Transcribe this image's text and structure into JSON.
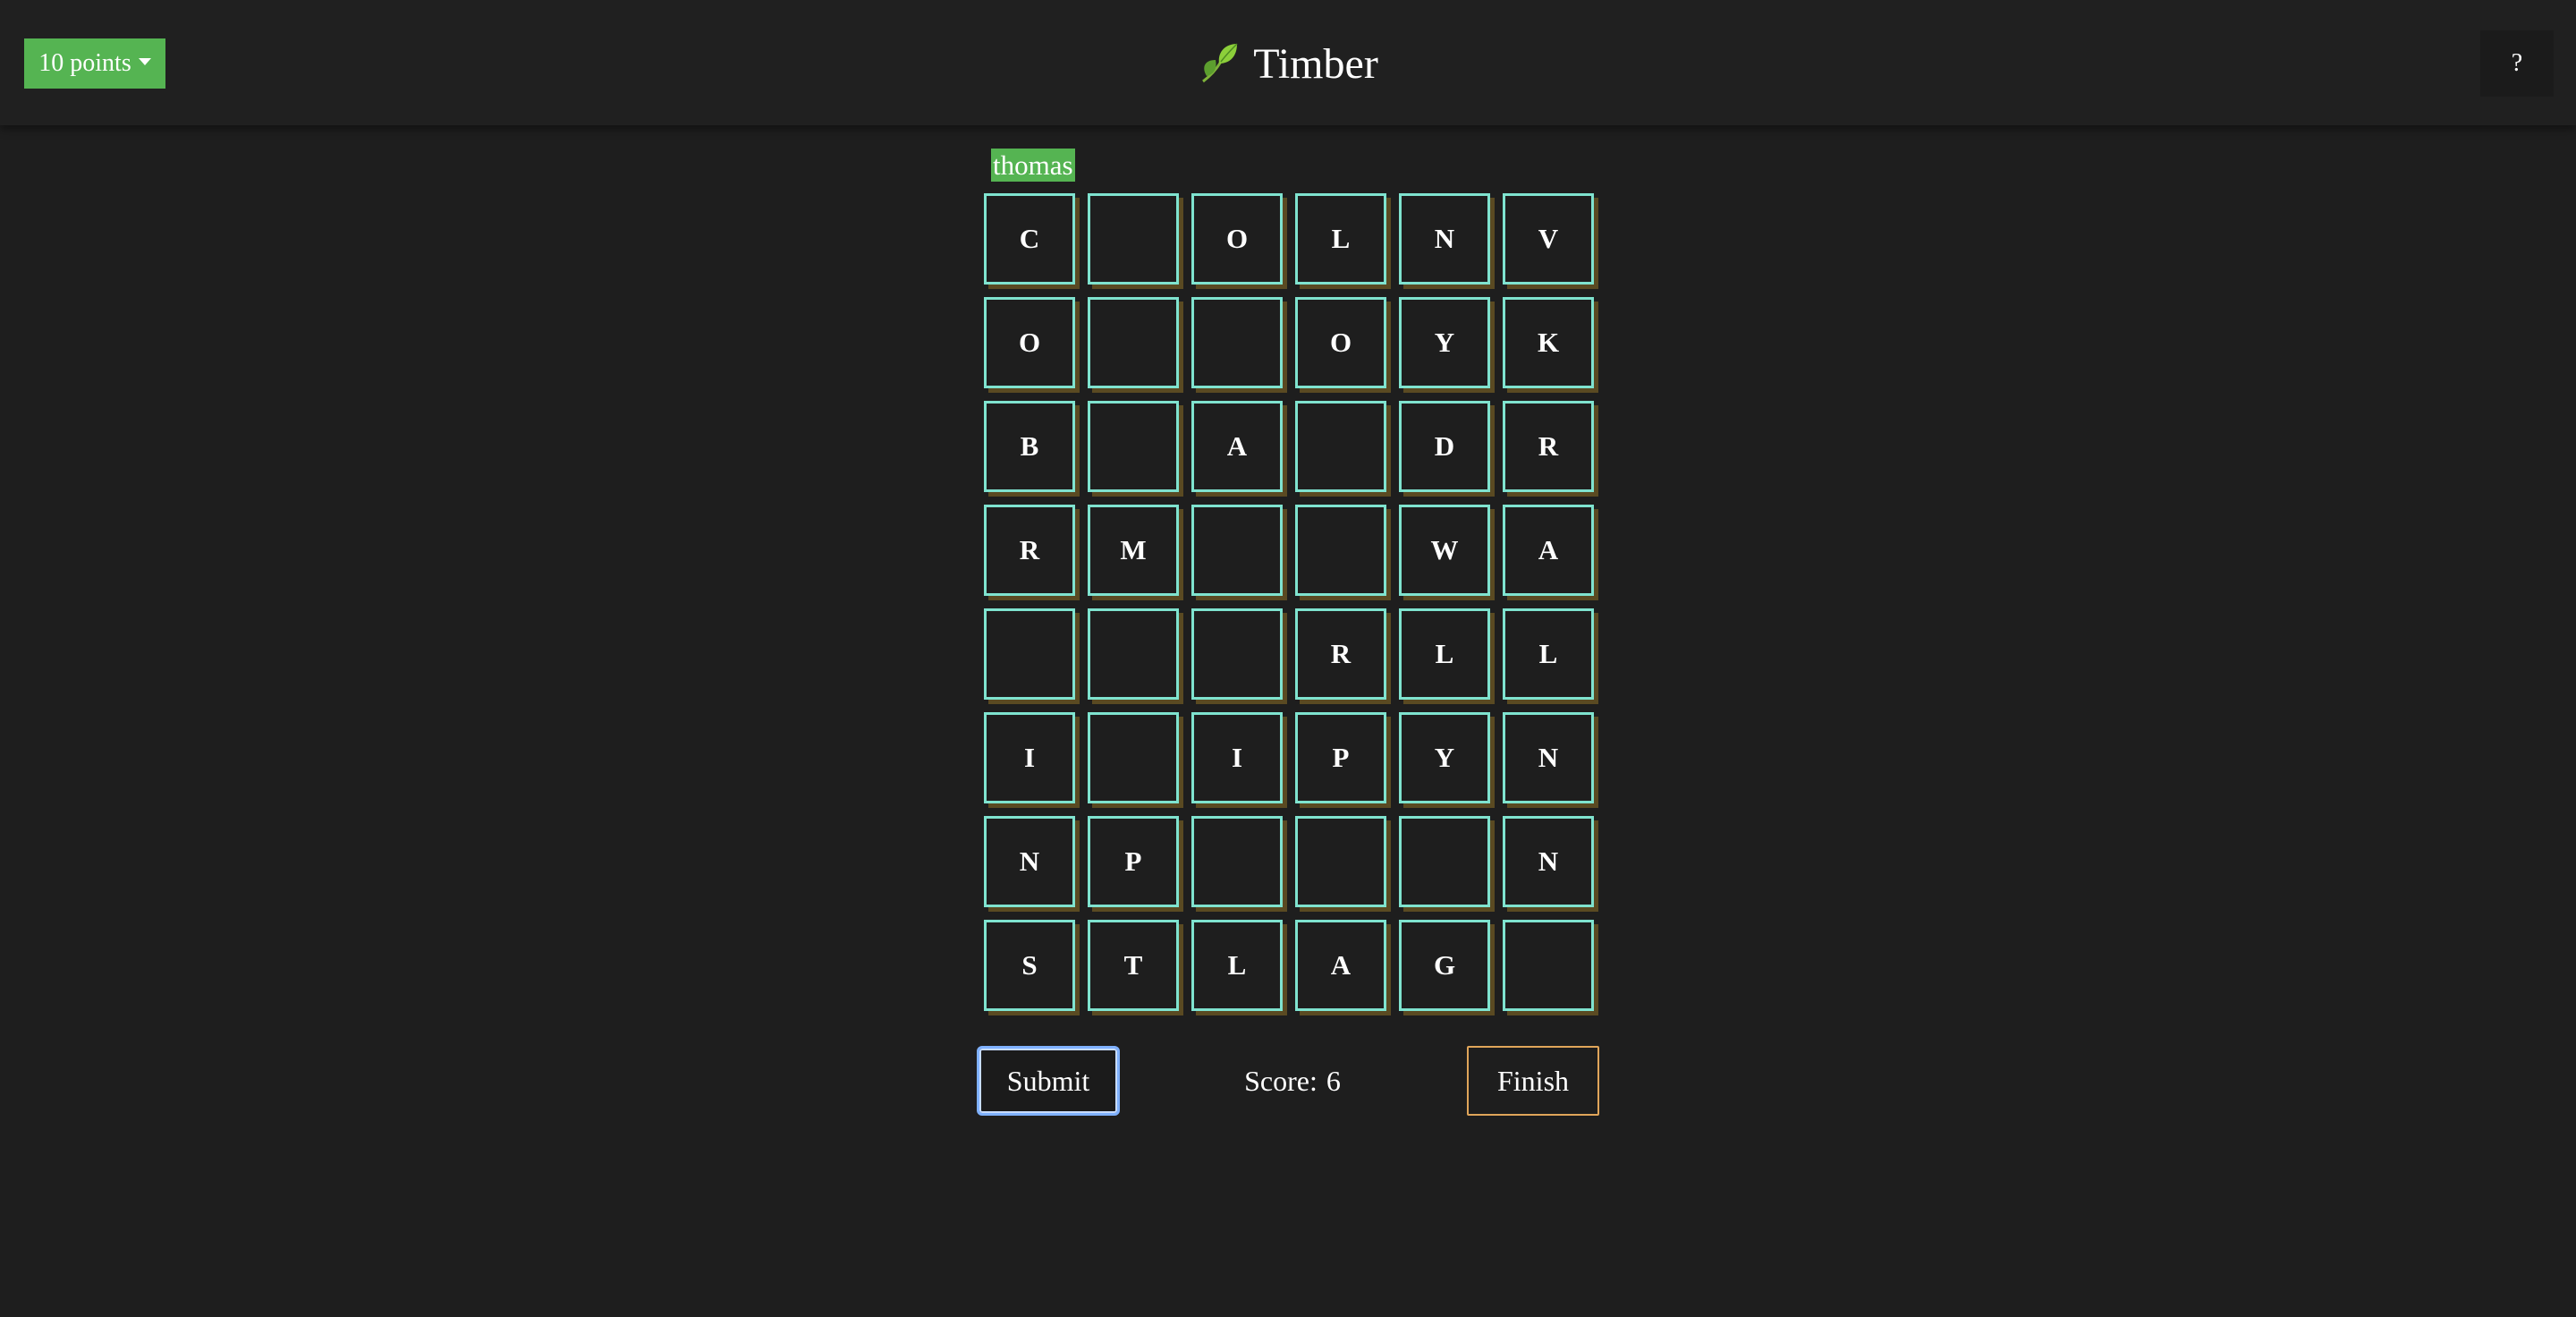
{
  "header": {
    "points_label": "10 points",
    "title": "Timber",
    "help_label": "?"
  },
  "player": {
    "name": "thomas"
  },
  "board": {
    "rows": 8,
    "cols": 6,
    "letters": [
      [
        "C",
        "",
        "O",
        "L",
        "N",
        "V"
      ],
      [
        "O",
        "",
        "",
        "O",
        "Y",
        "K"
      ],
      [
        "B",
        "",
        "A",
        "",
        "D",
        "R"
      ],
      [
        "R",
        "M",
        "",
        "",
        "W",
        "A"
      ],
      [
        "",
        "",
        "",
        "R",
        "L",
        "L"
      ],
      [
        "I",
        "",
        "I",
        "P",
        "Y",
        "N"
      ],
      [
        "N",
        "P",
        "",
        "",
        "",
        "N"
      ],
      [
        "S",
        "T",
        "L",
        "A",
        "G",
        ""
      ]
    ]
  },
  "actions": {
    "submit_label": "Submit",
    "score_label": "Score:",
    "score_value": "6",
    "finish_label": "Finish"
  },
  "colors": {
    "accent_green": "#55b452",
    "tile_border": "#7fe3cf",
    "finish_border": "#e0a55a",
    "submit_border": "#7fb1ff",
    "background": "#1e1e1e"
  },
  "icons": {
    "logo": "leaf-icon",
    "dropdown": "caret-down-icon"
  }
}
